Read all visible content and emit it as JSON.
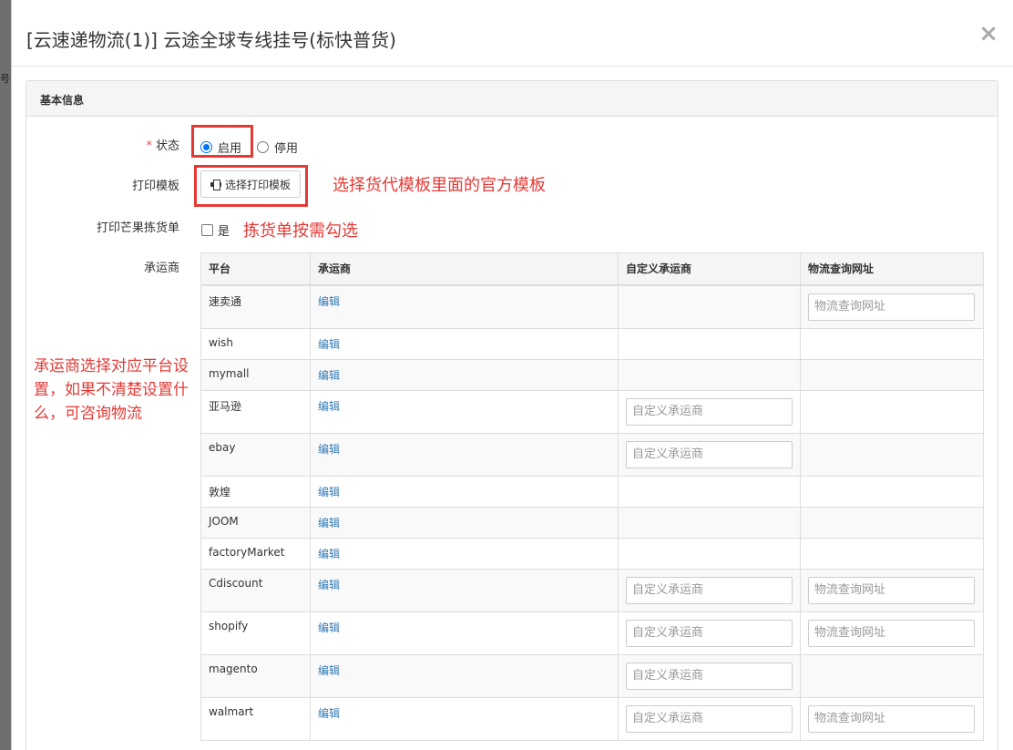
{
  "backdrop": {
    "fragment": "号)"
  },
  "modal": {
    "title": "[云速递物流(1)] 云途全球专线挂号(标快普货)",
    "close": "×"
  },
  "panel": {
    "heading": "基本信息"
  },
  "form": {
    "status_label": "状态",
    "required_mark": "*",
    "status_on": "启用",
    "status_off": "停用",
    "template_label": "打印模板",
    "template_button": "选择打印模板",
    "mango_label": "打印芒果拣货单",
    "mango_option": "是",
    "carrier_label": "承运商"
  },
  "annotations": {
    "template_note": "选择货代模板里面的官方模板",
    "picking_note": "拣货单按需勾选",
    "carrier_note": "承运商选择对应平台设置，如果不清楚设置什么，可咨询物流"
  },
  "table": {
    "headers": [
      "平台",
      "承运商",
      "自定义承运商",
      "物流查询网址"
    ],
    "edit_label": "编辑",
    "custom_placeholder": "自定义承运商",
    "url_placeholder": "物流查询网址",
    "rows": [
      {
        "platform": "速卖通",
        "custom": false,
        "url": true
      },
      {
        "platform": "wish",
        "custom": false,
        "url": false
      },
      {
        "platform": "mymall",
        "custom": false,
        "url": false
      },
      {
        "platform": "亚马逊",
        "custom": true,
        "url": false
      },
      {
        "platform": "ebay",
        "custom": true,
        "url": false
      },
      {
        "platform": "敦煌",
        "custom": false,
        "url": false
      },
      {
        "platform": "JOOM",
        "custom": false,
        "url": false
      },
      {
        "platform": "factoryMarket",
        "custom": false,
        "url": false
      },
      {
        "platform": "Cdiscount",
        "custom": true,
        "url": true
      },
      {
        "platform": "shopify",
        "custom": true,
        "url": true
      },
      {
        "platform": "magento",
        "custom": true,
        "url": false
      },
      {
        "platform": "walmart",
        "custom": true,
        "url": true
      }
    ]
  },
  "colors": {
    "annotation": "#e53935",
    "link": "#337ab7",
    "radio_accent": "#0075ff"
  }
}
